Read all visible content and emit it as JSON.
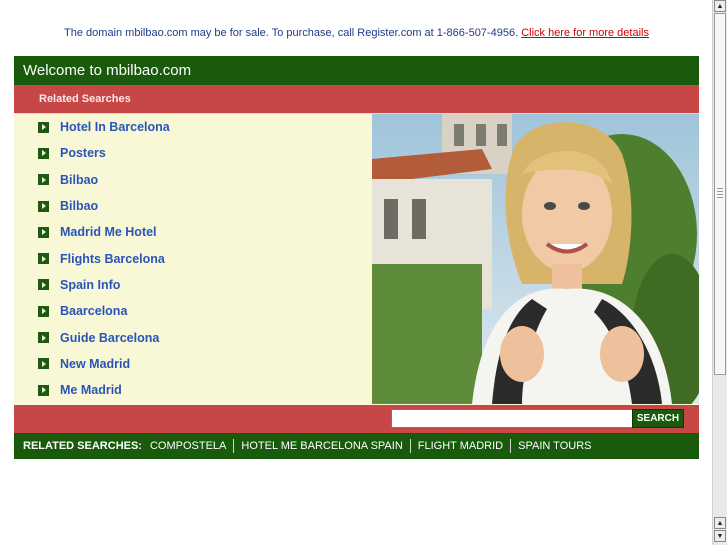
{
  "notice": {
    "text": "The domain mbilbao.com may be for sale. To purchase, call Register.com at 1-866-507-4956.",
    "link": "Click here for more details"
  },
  "header": {
    "title": "Welcome to mbilbao.com"
  },
  "related_header": "Related Searches",
  "links": [
    "Hotel In Barcelona",
    "Posters",
    "Bilbao",
    "Bilbao",
    "Madrid Me Hotel",
    "Flights Barcelona",
    "Spain Info",
    "Baarcelona",
    "Guide Barcelona",
    "New Madrid",
    "Me Madrid"
  ],
  "search": {
    "value": "",
    "button": "SEARCH"
  },
  "related_bar": {
    "label": "RELATED SEARCHES:",
    "items": [
      "COMPOSTELA",
      "HOTEL ME BARCELONA SPAIN",
      "FLIGHT MADRID",
      "SPAIN TOURS"
    ]
  },
  "icons": {
    "bullet": "arrow-right-icon",
    "scroll_up": "arrow-up-icon",
    "scroll_down": "arrow-down-icon"
  },
  "colors": {
    "green": "#1a5a0c",
    "red": "#c74646",
    "cream": "#f8f7d6",
    "link": "#2a55b8"
  }
}
